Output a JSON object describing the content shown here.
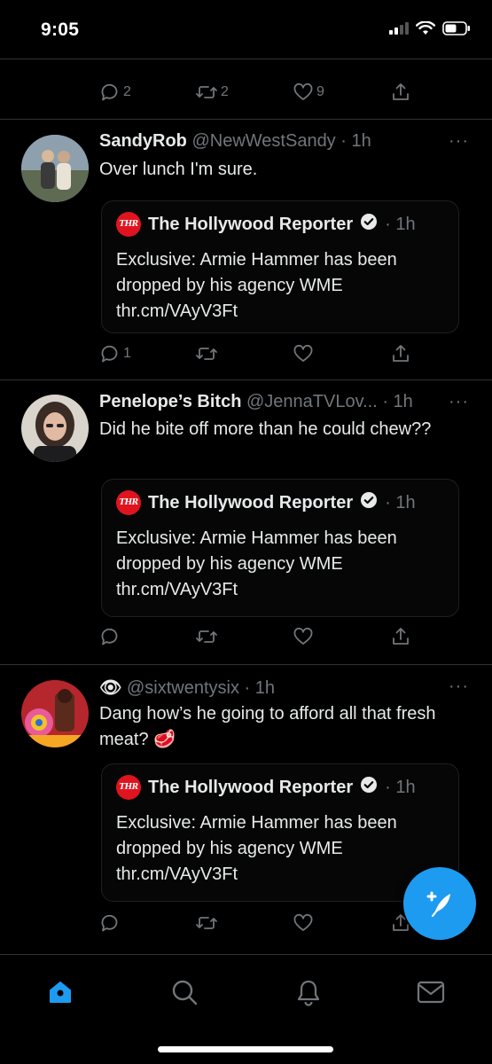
{
  "status_bar": {
    "time": "9:05"
  },
  "top_actions": {
    "reply_count": "2",
    "retweet_count": "2",
    "like_count": "9"
  },
  "tweets": [
    {
      "name": "SandyRob",
      "handle": "@NewWestSandy",
      "time": "· 1h",
      "text": "Over lunch I'm sure.",
      "reply_count": "1",
      "retweet_count": "",
      "like_count": "",
      "quote": {
        "logo": "THR",
        "name": "The Hollywood Reporter",
        "time": "· 1h",
        "text": "Exclusive: Armie Hammer has been dropped by his agency WME thr.cm/VAyV3Ft"
      }
    },
    {
      "name": "Penelope’s Bitch",
      "handle": "@JennaTVLov...",
      "time": "· 1h",
      "text": "Did he bite off more than he could chew??",
      "reply_count": "",
      "retweet_count": "",
      "like_count": "",
      "quote": {
        "logo": "THR",
        "name": "The Hollywood Reporter",
        "time": "· 1h",
        "text": "Exclusive: Armie Hammer has been dropped by his agency WME thr.cm/VAyV3Ft"
      }
    },
    {
      "name": "👁",
      "handle": "@sixtwentysix",
      "time": "· 1h",
      "text": "Dang how’s he going to afford all that fresh meat? 🥩",
      "reply_count": "",
      "retweet_count": "",
      "like_count": "",
      "quote": {
        "logo": "THR",
        "name": "The Hollywood Reporter",
        "time": "· 1h",
        "text": "Exclusive: Armie Hammer has been dropped by his agency WME thr.cm/VAyV3Ft"
      }
    }
  ],
  "more_label": "···",
  "colors": {
    "accent": "#1d9bf0",
    "thr_red": "#e0141e",
    "muted": "#71767b",
    "background": "#000000"
  },
  "tabbar": {
    "items": [
      "home-icon",
      "search-icon",
      "notifications-icon",
      "messages-icon"
    ],
    "active": "home-icon"
  }
}
